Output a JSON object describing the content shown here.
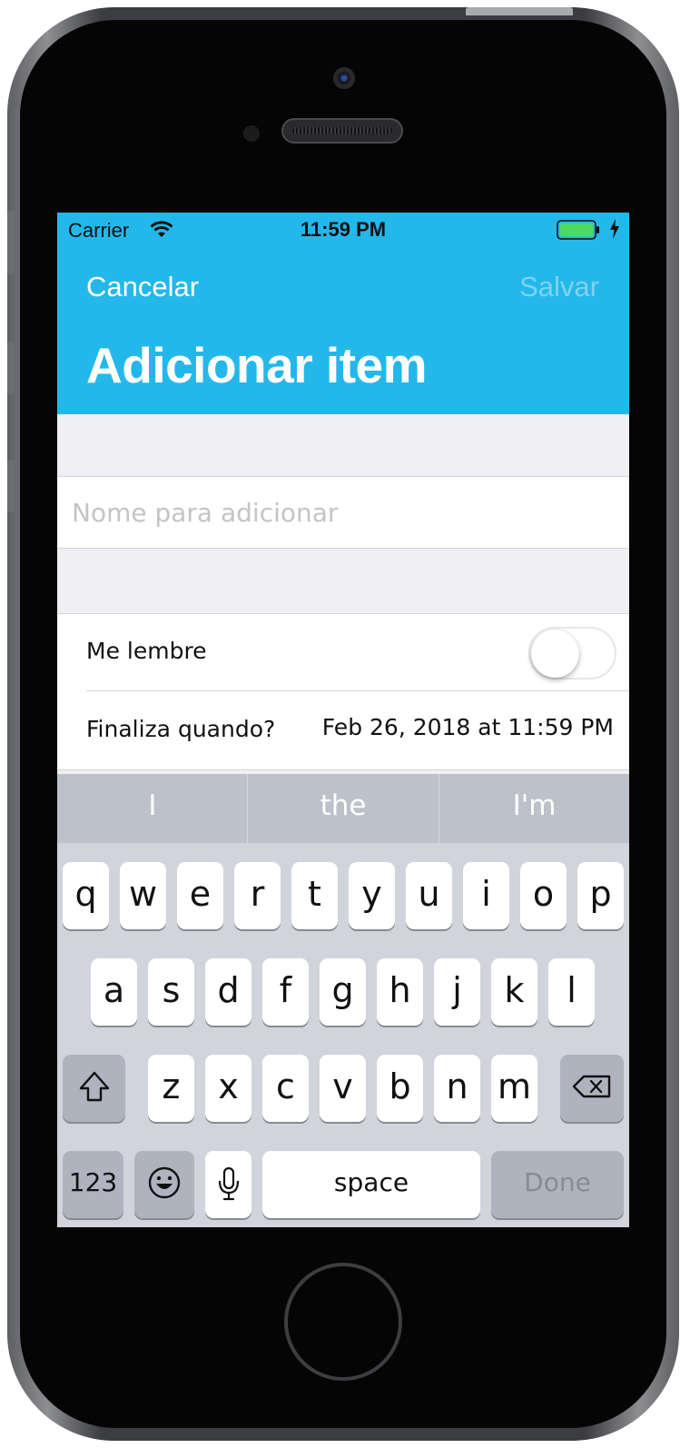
{
  "status_bar": {
    "carrier": "Carrier",
    "time": "11:59 PM",
    "battery_color": "#4cd964"
  },
  "nav": {
    "cancel_label": "Cancelar",
    "save_label": "Salvar",
    "title": "Adicionar item",
    "background": "#24b8ea"
  },
  "form": {
    "name_placeholder": "Nome para adicionar",
    "name_value": "",
    "remind_label": "Me lembre",
    "remind_on": false,
    "end_label": "Finaliza quando?",
    "end_value": "Feb 26, 2018 at 11:59 PM"
  },
  "keyboard": {
    "suggestions": [
      "I",
      "the",
      "I'm"
    ],
    "row1": [
      "q",
      "w",
      "e",
      "r",
      "t",
      "y",
      "u",
      "i",
      "o",
      "p"
    ],
    "row2": [
      "a",
      "s",
      "d",
      "f",
      "g",
      "h",
      "j",
      "k",
      "l"
    ],
    "row3": [
      "z",
      "x",
      "c",
      "v",
      "b",
      "n",
      "m"
    ],
    "numbers_label": "123",
    "space_label": "space",
    "done_label": "Done",
    "icons": {
      "shift": "shift-icon",
      "delete": "delete-icon",
      "emoji": "emoji-icon",
      "mic": "microphone-icon"
    }
  }
}
